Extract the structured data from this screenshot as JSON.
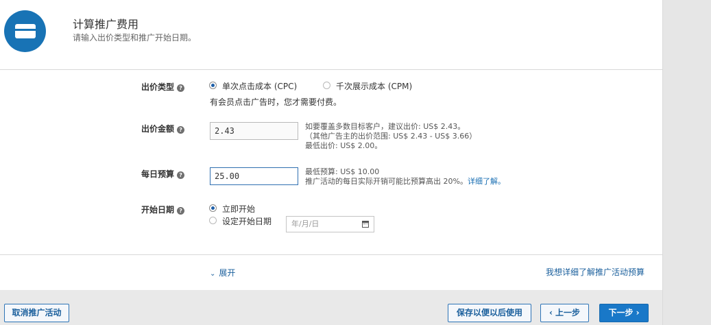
{
  "header": {
    "icon": "credit-card-icon",
    "title": "计算推广费用",
    "subtitle": "请输入出价类型和推广开始日期。"
  },
  "bid_type": {
    "label": "出价类型",
    "options": [
      {
        "label": "单次点击成本 (CPC)",
        "checked": true
      },
      {
        "label": "千次展示成本 (CPM)",
        "checked": false
      }
    ],
    "description": "有会员点击广告时，您才需要付费。"
  },
  "bid_amount": {
    "label": "出价金额",
    "value": "2.43",
    "hints": [
      "如要覆盖多数目标客户，建议出价: US$  2.43。",
      "（其他广告主的出价范围: US$  2.43 - US$  3.66）",
      "最低出价: US$  2.00。"
    ]
  },
  "daily_budget": {
    "label": "每日预算",
    "value": "25.00",
    "hints": [
      "最低预算: US$  10.00",
      "推广活动的每日实际开销可能比预算高出 20%。"
    ],
    "learn_more": "详细了解。"
  },
  "start_date": {
    "label": "开始日期",
    "options": [
      {
        "label": "立即开始",
        "checked": true
      },
      {
        "label": "设定开始日期",
        "checked": false
      }
    ],
    "date_placeholder": "年/月/日"
  },
  "footer": {
    "expand_label": "展开",
    "learn_budget_link": "我想详细了解推广活动预算"
  },
  "buttons": {
    "cancel": "取消推广活动",
    "save_later": "保存以便以后使用",
    "prev": "‹ 上一步",
    "next": "下一步 ›"
  },
  "colors": {
    "accent": "#1978c8",
    "link": "#1a5f9c",
    "icon_circle": "#1873b5"
  }
}
